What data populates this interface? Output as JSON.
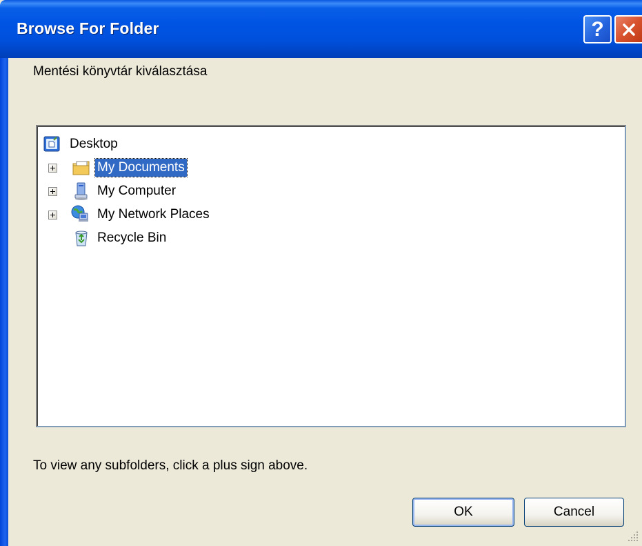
{
  "window": {
    "title": "Browse For Folder",
    "help_glyph": "?",
    "close_glyph": "✕"
  },
  "prompt": "Mentési könyvtár kiválasztása",
  "tree": {
    "items": [
      {
        "label": "Desktop",
        "icon": "desktop-icon",
        "expandable": false,
        "selected": false
      },
      {
        "label": "My Documents",
        "icon": "my-documents-icon",
        "expandable": true,
        "selected": true
      },
      {
        "label": "My Computer",
        "icon": "my-computer-icon",
        "expandable": true,
        "selected": false
      },
      {
        "label": "My Network Places",
        "icon": "network-places-icon",
        "expandable": true,
        "selected": false
      },
      {
        "label": "Recycle Bin",
        "icon": "recycle-bin-icon",
        "expandable": false,
        "selected": false
      }
    ]
  },
  "hint": "To view any subfolders, click a plus sign above.",
  "buttons": {
    "ok": "OK",
    "cancel": "Cancel"
  },
  "colors": {
    "titlebar": "#0054e3",
    "selection": "#316ac5",
    "dialog_bg": "#ece9d8"
  }
}
